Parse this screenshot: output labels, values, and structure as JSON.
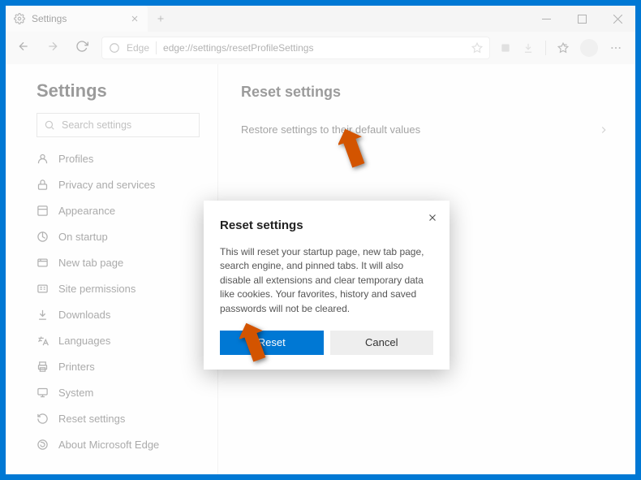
{
  "tab": {
    "label": "Settings"
  },
  "address": {
    "name": "Edge",
    "url": "edge://settings/resetProfileSettings"
  },
  "sidebar": {
    "title": "Settings",
    "search_placeholder": "Search settings",
    "items": [
      {
        "label": "Profiles"
      },
      {
        "label": "Privacy and services"
      },
      {
        "label": "Appearance"
      },
      {
        "label": "On startup"
      },
      {
        "label": "New tab page"
      },
      {
        "label": "Site permissions"
      },
      {
        "label": "Downloads"
      },
      {
        "label": "Languages"
      },
      {
        "label": "Printers"
      },
      {
        "label": "System"
      },
      {
        "label": "Reset settings"
      },
      {
        "label": "About Microsoft Edge"
      }
    ]
  },
  "main": {
    "title": "Reset settings",
    "row_label": "Restore settings to their default values"
  },
  "dialog": {
    "title": "Reset settings",
    "body": "This will reset your startup page, new tab page, search engine, and pinned tabs. It will also disable all extensions and clear temporary data like cookies. Your favorites, history and saved passwords will not be cleared.",
    "primary": "Reset",
    "secondary": "Cancel"
  }
}
